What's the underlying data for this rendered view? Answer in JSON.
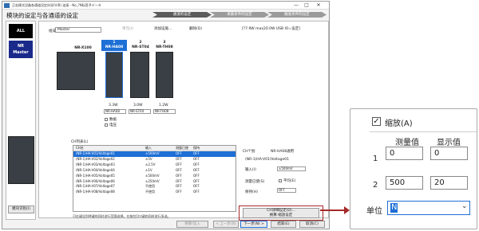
{
  "window": {
    "title": "正宏模式设备各通道设定向导(V/B) 连接 - No_?N标签予データ",
    "minimize": "—",
    "maximize": "□",
    "close": "✕"
  },
  "heading": "模块的设定与各通道的设定",
  "steps": [
    "通道的设定",
    "采集条件的设定",
    "触发条件的设定"
  ],
  "left": {
    "all": "ALL",
    "nr": "NR",
    "master": "Master",
    "import_button": "模块识别(I)"
  },
  "toolbar": {
    "group_label": "组成",
    "group_value": "Master",
    "module_button": "单元(I)",
    "add_button": "添加设施...",
    "delete_button": "删除(D)",
    "info": "[?7.9W max20.0W USB IO=设定]"
  },
  "modules": [
    {
      "num": "",
      "name": "NR-X100",
      "power": "",
      "select": ""
    },
    {
      "num": "1",
      "name": "NR-HA08",
      "power": "3.3W",
      "select": "NR-HA08"
    },
    {
      "num": "2",
      "name": "NR-ST04",
      "power": "3.0W",
      "select": "NR-ST04"
    },
    {
      "num": "3",
      "name": "NR-TH08",
      "power": "1.2W",
      "select": "NR-TH08"
    }
  ],
  "checks": [
    "数据",
    "电压"
  ],
  "ch_list_label": "CH列表(L)",
  "table": {
    "headers": [
      "CH名",
      "输入",
      "测量已使",
      "保持"
    ],
    "rows": [
      [
        "(NR-1)HA-V01/Voltage01",
        "±500mV",
        "OFF",
        "OFF"
      ],
      [
        "(NR-1)HA-V02/Voltage02",
        "±5V",
        "OFF",
        "OFF"
      ],
      [
        "(NR-1)HA-V03/Voltage03",
        "±2.5V",
        "OFF",
        "OFF"
      ],
      [
        "(NR-1)HA-V04/Voltage04",
        "±1V",
        "OFF",
        "OFF"
      ],
      [
        "(NR-1)HA-V05/Voltage05",
        "±500mV",
        "OFF",
        "OFF"
      ],
      [
        "(NR-1)HA-V06/Voltage06",
        "±250mV",
        "OFF",
        "OFF"
      ],
      [
        "(NR-1)HA-V07/Voltage07",
        "不使用",
        "OFF",
        "OFF"
      ],
      [
        "(NR-1)HA-V08/Voltage08",
        "不使用",
        "OFF",
        "OFF"
      ]
    ],
    "note": "可在键设列M键的同时进行范围选择。在按住Ctrl键的同时进行多选。"
  },
  "detail": {
    "ch_label": "CH个别",
    "ch_module": "NR-HA08通用",
    "ch_name": "(NR-1)HA-V01/Voltage01",
    "input_label": "输入(I)",
    "input_value": "±500mV",
    "measure_label": "测量已使(S)",
    "measure_check": "平均(E)",
    "hold_label": "保持(H)",
    "hold_value": "OFF",
    "button_line1": "CH详细设定(D)...",
    "button_line2": "换算·缩放设定"
  },
  "bottom": {
    "prev": "< 上一步(B)",
    "next": "下一步(N) >",
    "finish": "结束(E)",
    "cancel": "取消(C)",
    "extra": "换算/读入"
  },
  "zoom": {
    "checkbox_label": "缩放(A)",
    "col_measure": "测量值",
    "col_display": "显示值",
    "row1": "1",
    "row2": "2",
    "r1_measure": "0",
    "r1_display": "0",
    "r2_measure": "500",
    "r2_display": "20",
    "unit_label": "单位",
    "unit_value": "N"
  },
  "colors": {
    "step_active": "#5b5b5b",
    "step_inactive": "#9a9a9a",
    "highlight": "#a52a2a",
    "select_blue": "#1e6fd6",
    "left_black": "#000000",
    "left_blue": "#1a2a8a"
  }
}
